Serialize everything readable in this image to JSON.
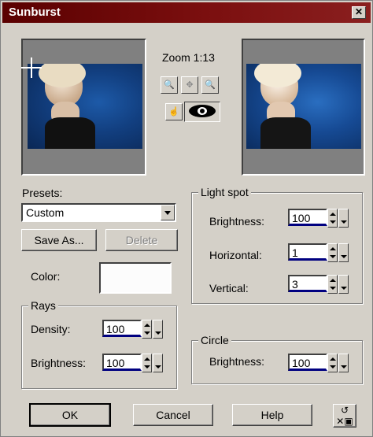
{
  "window": {
    "title": "Sunburst"
  },
  "zoom": {
    "label": "Zoom 1:13"
  },
  "presets": {
    "label": "Presets:",
    "value": "Custom"
  },
  "buttons": {
    "save_as": "Save As...",
    "delete": "Delete",
    "ok": "OK",
    "cancel": "Cancel",
    "help": "Help"
  },
  "color": {
    "label": "Color:",
    "value": "#fcfcfc"
  },
  "light_spot": {
    "title": "Light spot",
    "brightness_label": "Brightness:",
    "brightness": "100",
    "horizontal_label": "Horizontal:",
    "horizontal": "1",
    "vertical_label": "Vertical:",
    "vertical": "3"
  },
  "rays": {
    "title": "Rays",
    "density_label": "Density:",
    "density": "100",
    "brightness_label": "Brightness:",
    "brightness": "100"
  },
  "circle": {
    "title": "Circle",
    "brightness_label": "Brightness:",
    "brightness": "100"
  }
}
